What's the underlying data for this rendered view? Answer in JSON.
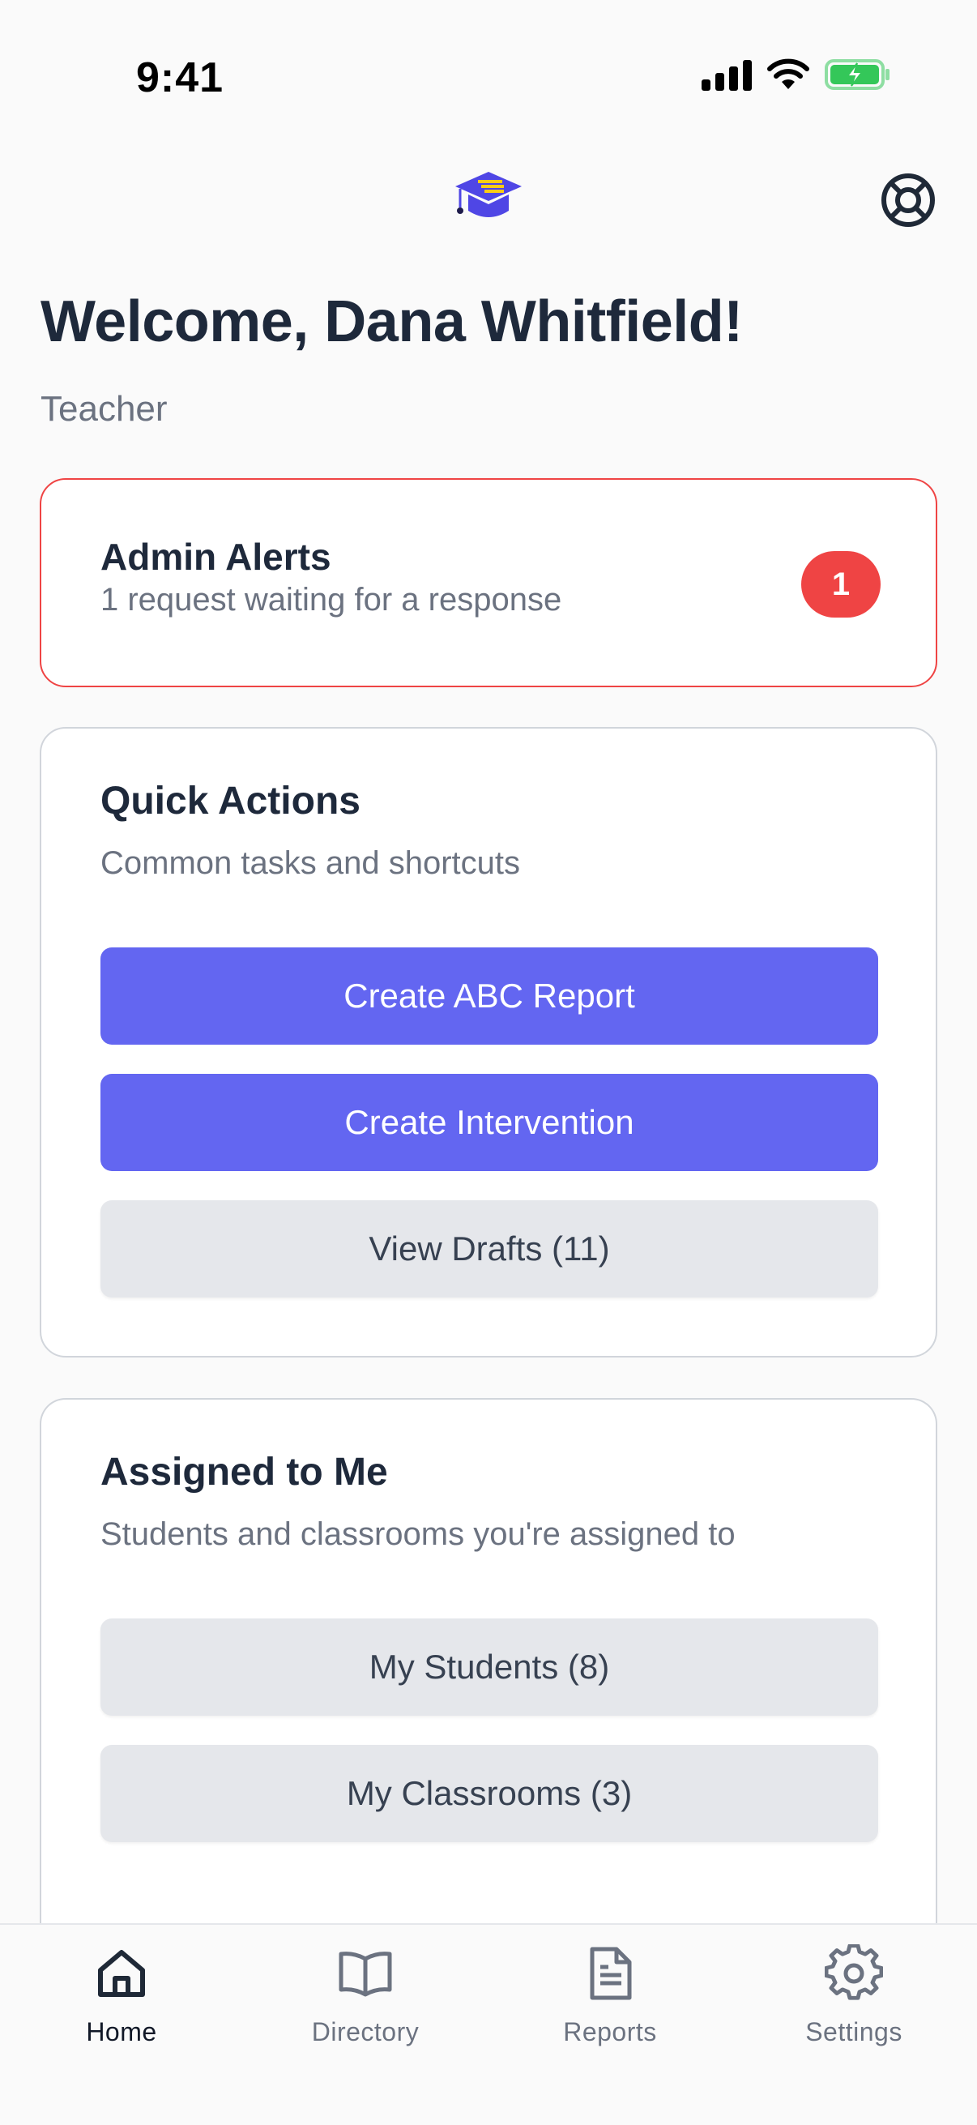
{
  "status_bar": {
    "time": "9:41"
  },
  "header": {
    "welcome": "Welcome, Dana Whitfield!",
    "role": "Teacher"
  },
  "admin_alerts": {
    "title": "Admin Alerts",
    "subtitle": "1 request waiting for a response",
    "badge_count": "1"
  },
  "quick_actions": {
    "title": "Quick Actions",
    "subtitle": "Common tasks and shortcuts",
    "buttons": [
      {
        "label": "Create ABC Report"
      },
      {
        "label": "Create Intervention"
      },
      {
        "label": "View Drafts (11)"
      }
    ]
  },
  "assigned": {
    "title": "Assigned to Me",
    "subtitle": "Students and classrooms you're assigned to",
    "buttons": [
      {
        "label": "My Students (8)"
      },
      {
        "label": "My Classrooms (3)"
      }
    ]
  },
  "tabs": [
    {
      "label": "Home",
      "icon": "home-icon",
      "active": true
    },
    {
      "label": "Directory",
      "icon": "book-icon",
      "active": false
    },
    {
      "label": "Reports",
      "icon": "document-icon",
      "active": false
    },
    {
      "label": "Settings",
      "icon": "gear-icon",
      "active": false
    }
  ],
  "colors": {
    "primary": "#6366f1",
    "alert": "#ef4444",
    "secondary_button": "#e5e7eb",
    "battery": "#34c759"
  }
}
